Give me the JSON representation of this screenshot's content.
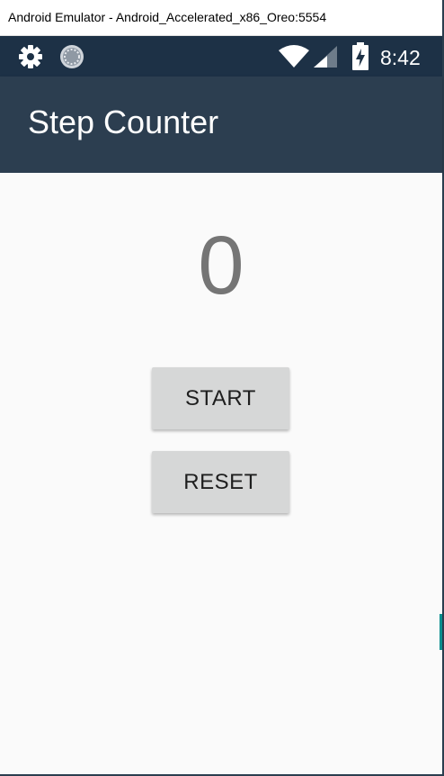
{
  "window": {
    "title": "Android Emulator - Android_Accelerated_x86_Oreo:5554"
  },
  "status_bar": {
    "time": "8:42",
    "icons": [
      "gear-icon",
      "sync-icon",
      "wifi-icon",
      "signal-icon",
      "battery-charging-icon"
    ]
  },
  "app_bar": {
    "title": "Step Counter"
  },
  "main": {
    "step_count": "0",
    "start_label": "START",
    "reset_label": "RESET"
  },
  "colors": {
    "status_bar": "#1d3146",
    "app_bar": "#2c3e50",
    "background": "#fafafa",
    "button": "#d6d7d7",
    "counter_text": "#757575"
  }
}
